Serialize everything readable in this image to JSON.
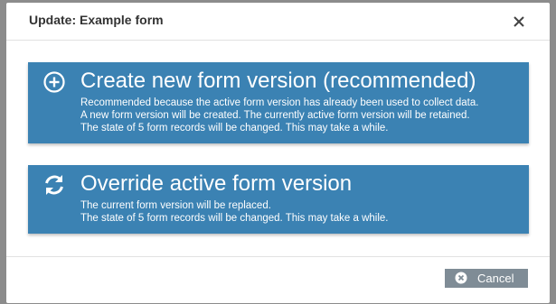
{
  "dialog": {
    "title": "Update: Example form",
    "close_icon": "close-icon"
  },
  "options": [
    {
      "icon": "plus-circle-icon",
      "title": "Create new form version (recommended)",
      "lines": [
        "Recommended because the active form version has already been used to collect data.",
        "A new form version will be created. The currently active form version will be retained.",
        "The state of 5 form records will be changed. This may take a while."
      ]
    },
    {
      "icon": "sync-icon",
      "title": "Override active form version",
      "lines": [
        "The current form version will be replaced.",
        "The state of 5 form records will be changed. This may take a while."
      ]
    }
  ],
  "footer": {
    "cancel_label": "Cancel",
    "cancel_icon": "cancel-circle-icon"
  },
  "colors": {
    "option_bg": "#3b82b3",
    "cancel_bg": "#7f8c96"
  }
}
